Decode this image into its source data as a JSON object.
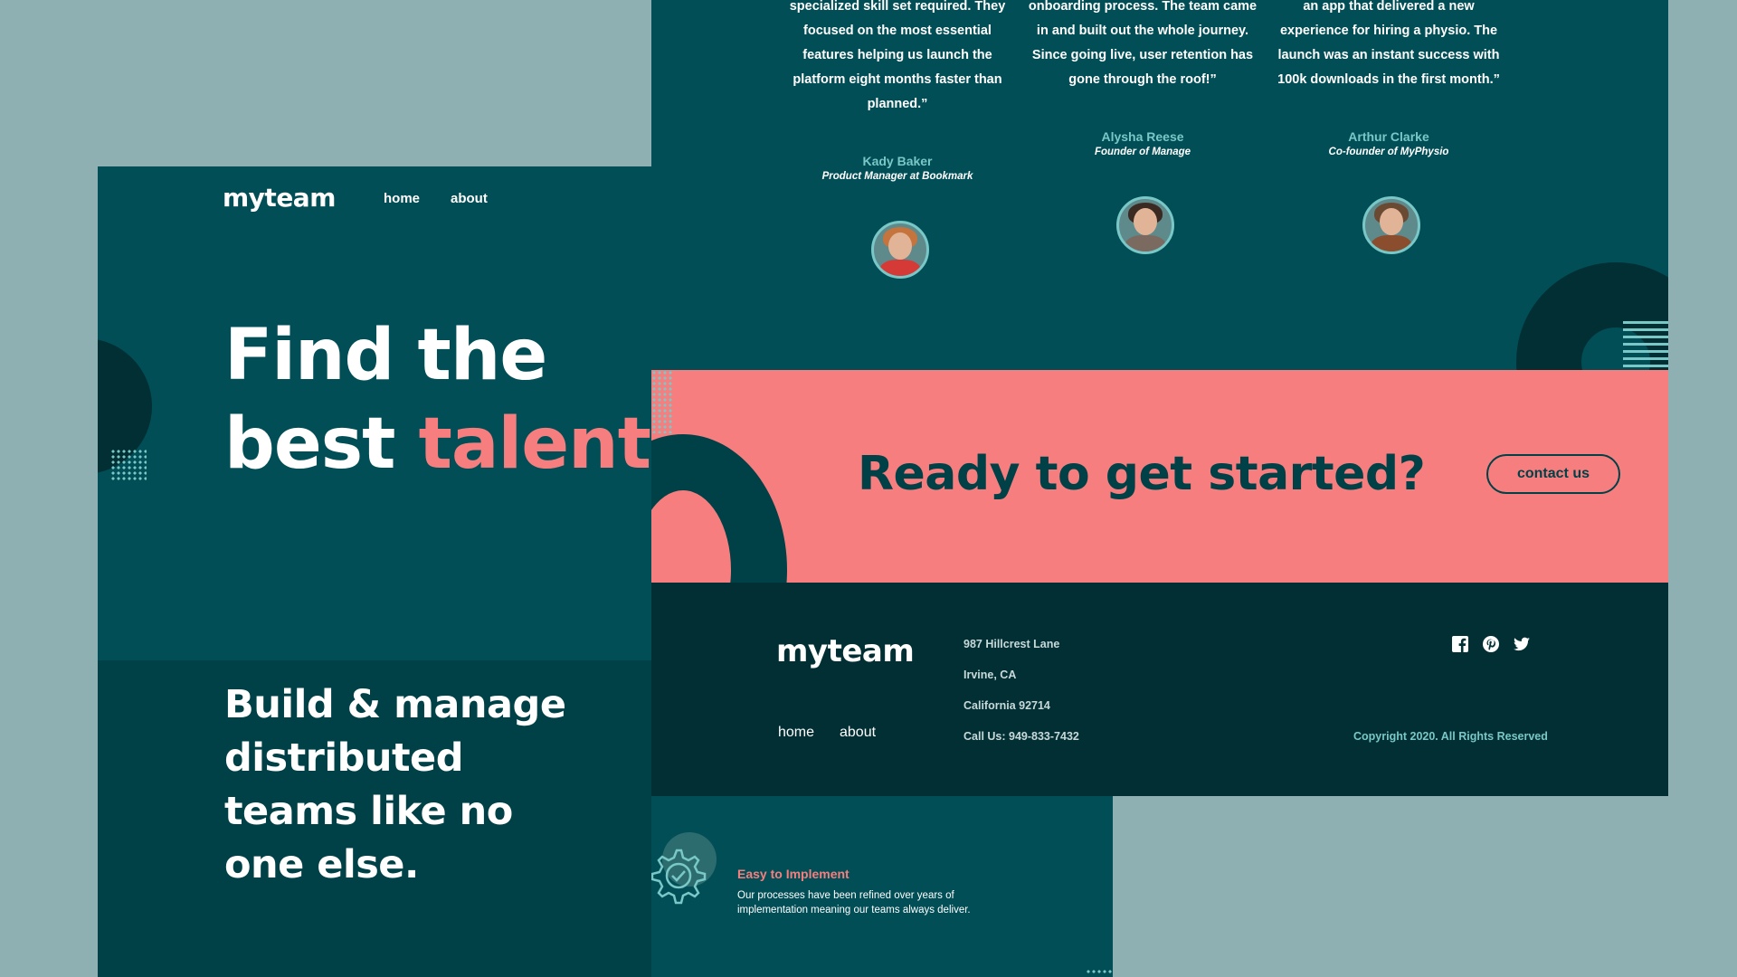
{
  "hero": {
    "logo": "myteam",
    "nav": {
      "home": "home",
      "about": "about"
    },
    "title_line1": "Find the",
    "title_line2_plain": "best ",
    "title_line2_accent": "talent",
    "subtitle": "Build & manage distributed teams like no one else."
  },
  "feature": {
    "title": "Easy to Implement",
    "text": "Our processes have been refined over years of implementation meaning our teams always deliver."
  },
  "testimonials": [
    {
      "quote": "specialized skill set required. They focused on the most essential features helping us launch the platform eight months faster than planned.”",
      "name": "Kady Baker",
      "role": "Product Manager at Bookmark"
    },
    {
      "quote": "onboarding process. The team came in and built out the whole journey. Since going live, user retention has gone through the roof!”",
      "name": "Alysha Reese",
      "role": "Founder of Manage"
    },
    {
      "quote": "an app that delivered a new experience for hiring a physio. The launch was an instant success with 100k downloads in the first month.”",
      "name": "Arthur Clarke",
      "role": "Co-founder of MyPhysio"
    }
  ],
  "cta": {
    "text": "Ready to get started?",
    "button": "contact us"
  },
  "footer": {
    "logo": "myteam",
    "nav": {
      "home": "home",
      "about": "about"
    },
    "address": [
      "987 Hillcrest Lane",
      "Irvine, CA",
      "California 92714",
      "Call Us: 949-833-7432"
    ],
    "social": [
      "facebook-icon",
      "pinterest-icon",
      "twitter-icon"
    ],
    "copyright": "Copyright 2020. All Rights Reserved"
  },
  "colors": {
    "background": "#8eb0b2",
    "primary": "#014e56",
    "dark": "#004047",
    "footer": "#012f34",
    "coral": "#f67e7e",
    "teal_accent": "#79c8c7"
  }
}
